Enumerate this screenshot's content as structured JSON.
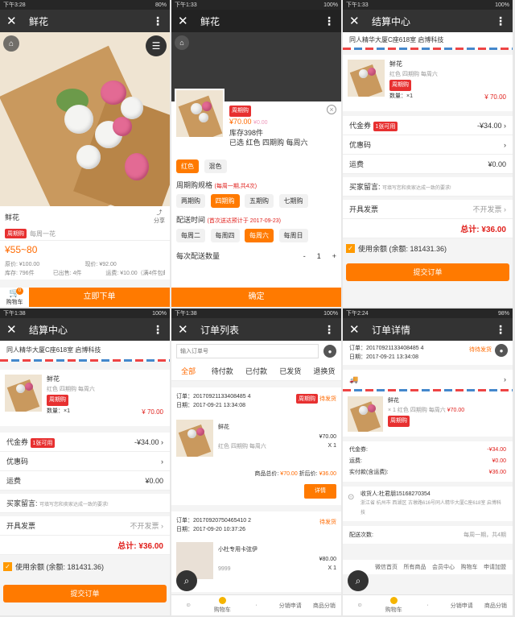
{
  "status": {
    "t1": "下午3:28",
    "b1": "80%",
    "t2": "下午1:33",
    "b2": "100%",
    "t3": "下午1:33",
    "b3": "100%",
    "t4": "下午1:38",
    "b4": "100%",
    "t5": "下午1:38",
    "b5": "100%",
    "t6": "下午2:24",
    "b6": "98%"
  },
  "p1": {
    "title": "鲜花",
    "product_name": "鲜花",
    "share": "分享",
    "tag": "周期购",
    "cycle": "每周一花",
    "price": "¥55~80",
    "stat_labels": [
      "原价: ¥100.00",
      "现价: ¥92.00",
      "库存: 796件",
      "已出售: 4件",
      "运费: ¥10.00（满4件包邮）"
    ],
    "cart": "购物车",
    "cart_count": "0",
    "buy": "立即下单"
  },
  "p2": {
    "title": "鲜花",
    "tag": "周期购",
    "price": "¥70.00",
    "old_price": "¥0.00",
    "stock": "库存398件",
    "selected": "已选 红色 四期购 每周六",
    "colors": [
      "红色",
      "混色"
    ],
    "spec_title": "周期购规格",
    "spec_note": "(每周一期,共4次)",
    "specs": [
      "两期购",
      "四期购",
      "五期购",
      "七期购"
    ],
    "delivery_title": "配送时间",
    "delivery_note": "(首次送达预计于 2017-09-23)",
    "days": [
      "每周二",
      "每周四",
      "每周六",
      "每周日"
    ],
    "qty_label": "每次配送数量",
    "qty": "1",
    "minus": "-",
    "plus": "+",
    "confirm": "确定"
  },
  "p3": {
    "title": "结算中心",
    "address": "同人精华大厦C座618室 启博科技",
    "item": "鲜花",
    "item_spec": "红色 四期购 每周六",
    "tag": "周期购",
    "qty": "数量：×1",
    "price": "¥ 70.00",
    "coupon": "代金券",
    "coupon_tag": "1张可用",
    "coupon_val": "-¥34.00",
    "promo": "优惠码",
    "freight": "运费",
    "freight_val": "¥0.00",
    "note_label": "买家留言:",
    "note_ph": "可填写您和卖家达成一致的要求!",
    "invoice": "开具发票",
    "invoice_val": "不开发票",
    "total_label": "总计:",
    "total": "¥36.00",
    "balance": "使用余额 (余额: 181431.36)",
    "submit": "提交订单"
  },
  "p4": {
    "title": "结算中心",
    "address": "同人精华大厦C座618室 启博科技",
    "item": "鲜花",
    "item_spec": "红色 四期购 每周六",
    "tag": "周期购",
    "qty": "数量：×1",
    "price": "¥ 70.00",
    "coupon": "代金券",
    "coupon_tag": "1张可用",
    "coupon_val": "-¥34.00",
    "promo": "优惠码",
    "freight": "运费",
    "freight_val": "¥0.00",
    "note_label": "买家留言:",
    "note_ph": "可填写您和卖家达成一致的要求!",
    "invoice": "开具发票",
    "invoice_val": "不开发票",
    "total_label": "总计:",
    "total": "¥36.00",
    "balance": "使用余额 (余额: 181431.36)",
    "submit": "提交订单"
  },
  "p5": {
    "title": "订单列表",
    "search_ph": "输入订单号",
    "tabs": [
      "全部",
      "待付款",
      "已付款",
      "已发货",
      "退换货"
    ],
    "o1_no": "订单：20170921133408485 4",
    "o1_date": "日期：2017-09-21 13:34:08",
    "o1_tag": "周期购",
    "o1_status": "待发货",
    "o1_item": "鲜花",
    "o1_spec": "红色 四期购 每周六",
    "o1_price": "¥70.00",
    "o1_qty": "X 1",
    "o1_sum_label": "商品总价:",
    "o1_sum": "¥70.00",
    "o1_disc_label": "折后价:",
    "o1_disc": "¥36.00",
    "o1_btn": "详情",
    "o2_no": "订单：20170920750465410 2",
    "o2_date": "日期：2017-09-20 10:37:26",
    "o2_status": "待发货",
    "o2_item": "小杜专用卡弦伊",
    "o2_price": "¥80.00",
    "o2_qty": "X 1",
    "o2_sub": "9999",
    "nav": [
      "",
      "购物车",
      "",
      "分销申请",
      "商品分销"
    ]
  },
  "p6": {
    "title": "订单详情",
    "order_no": "订单：20170921133408485 4",
    "order_date": "日期：2017-09-21 13:34:08",
    "status": "待待发货",
    "item": "鲜花",
    "item_spec": "× 1 红色 四期购 每周六",
    "item_price": "¥70.00",
    "tag": "周期购",
    "coupon": "代金券:",
    "coupon_val": "-¥34.00",
    "freight": "运费:",
    "freight_val": "¥0.00",
    "paid": "实付款(含运费):",
    "paid_val": "¥36.00",
    "receiver": "收货人:杜君朋15168270354",
    "addr": "浙江省 杭州市 西湖区 古墩路616号同人精华大厦C座618室 启博科技",
    "times_label": "配送次数:",
    "times_val": "每周一期，共4期",
    "nav": [
      "微信首页",
      "所有商品",
      "会员中心",
      "购物车",
      "申请加盟"
    ],
    "nav2": [
      "",
      "购物车",
      "",
      "分销申请",
      "商品分销"
    ]
  }
}
